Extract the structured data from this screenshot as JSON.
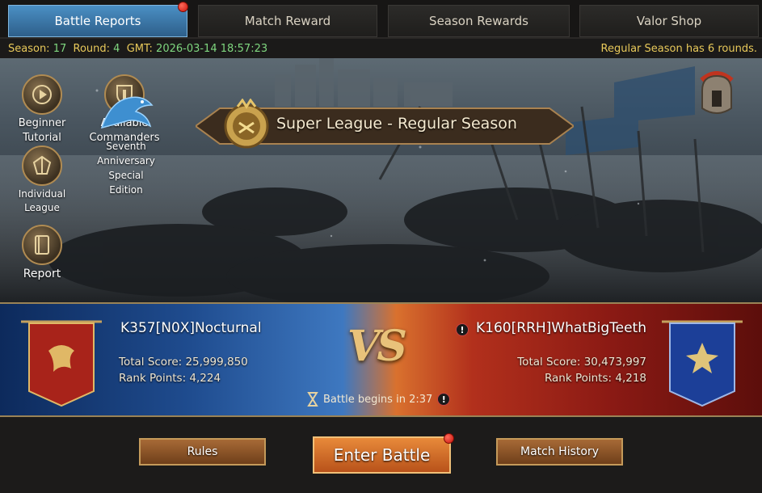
{
  "tabs": [
    {
      "label": "Battle Reports",
      "active": true
    },
    {
      "label": "Match Reward"
    },
    {
      "label": "Season Rewards"
    },
    {
      "label": "Valor Shop"
    }
  ],
  "info": {
    "season_label": "Season:",
    "season": "17",
    "round_label": "Round:",
    "round": "4",
    "gmt_label": "GMT:",
    "gmt": "2026-03-14 18:57:23",
    "rounds_note": "Regular Season has 6 rounds."
  },
  "sidebar": {
    "tutorial": [
      "Beginner",
      "Tutorial"
    ],
    "commanders": [
      "Available",
      "Commanders"
    ],
    "league": [
      "Individual",
      "League"
    ],
    "anniversary": [
      "Seventh",
      "Anniversary",
      "Special",
      "Edition"
    ],
    "report": "Report"
  },
  "league_title": "Super League - Regular Season",
  "match": {
    "left": {
      "name": "K357[N0X]Nocturnal",
      "total_score": "Total Score: 25,999,850",
      "rank_points": "Rank Points: 4,224"
    },
    "right": {
      "name": "K160[RRH]WhatBigTeeth",
      "total_score": "Total Score: 30,473,997",
      "rank_points": "Rank Points: 4,218"
    },
    "vs": "VS",
    "countdown": "Battle begins in 2:37"
  },
  "buttons": {
    "rules": "Rules",
    "enter": "Enter Battle",
    "history": "Match History"
  },
  "colors": {
    "tab_active": "#4a8fc4",
    "info_yellow": "#e8c95a",
    "info_green": "#7fd77f",
    "blue_side": "#1f4c8f",
    "red_side": "#8b1a14"
  },
  "icons": [
    "play-icon",
    "commander-shield-icon",
    "league-crest-icon",
    "dragon-icon",
    "book-icon",
    "league-emblem-icon",
    "helmet-icon",
    "hourglass-icon",
    "warning-icon"
  ]
}
